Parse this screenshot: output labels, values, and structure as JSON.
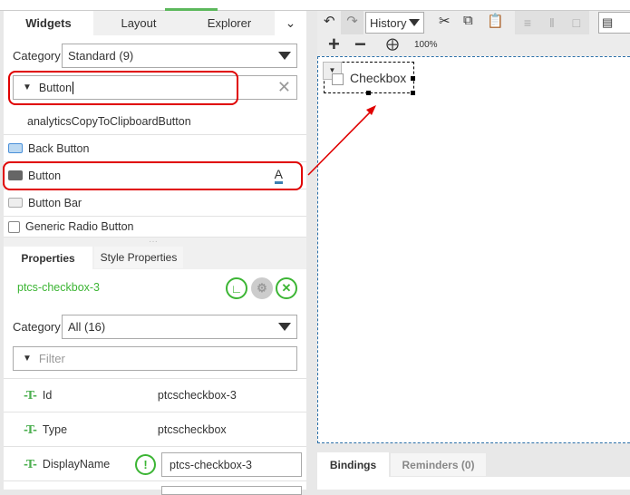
{
  "left_tabs": [
    "Widgets",
    "Layout",
    "Explorer"
  ],
  "widgets": {
    "category_label": "Category",
    "category_value": "Standard (9)",
    "filter_value": "Button",
    "items": [
      {
        "label": "analyticsCopyToClipboardButton",
        "icon": "none"
      },
      {
        "label": "Back Button",
        "icon": "back-button-icon"
      },
      {
        "label": "Button",
        "icon": "button-icon"
      },
      {
        "label": "Button Bar",
        "icon": "button-bar-icon"
      },
      {
        "label": "Generic Radio Button",
        "icon": "radio-list-icon"
      }
    ]
  },
  "props_tabs": [
    "Properties",
    "Style Properties"
  ],
  "props": {
    "widget_id": "ptcs-checkbox-3",
    "category_label": "Category",
    "category_value": "All (16)",
    "filter_placeholder": "Filter",
    "rows": [
      {
        "name": "Id",
        "value": "ptcscheckbox-3"
      },
      {
        "name": "Type",
        "value": "ptcscheckbox"
      },
      {
        "name": "DisplayName",
        "value": "ptcs-checkbox-3"
      }
    ]
  },
  "toolbar": {
    "history": "History",
    "zoom": "100%"
  },
  "canvas": {
    "widget_label": "Checkbox"
  },
  "bottom_tabs": [
    "Bindings",
    "Reminders (0)"
  ],
  "colors": {
    "accent": "#3cb534",
    "highlight": "#e00000"
  }
}
